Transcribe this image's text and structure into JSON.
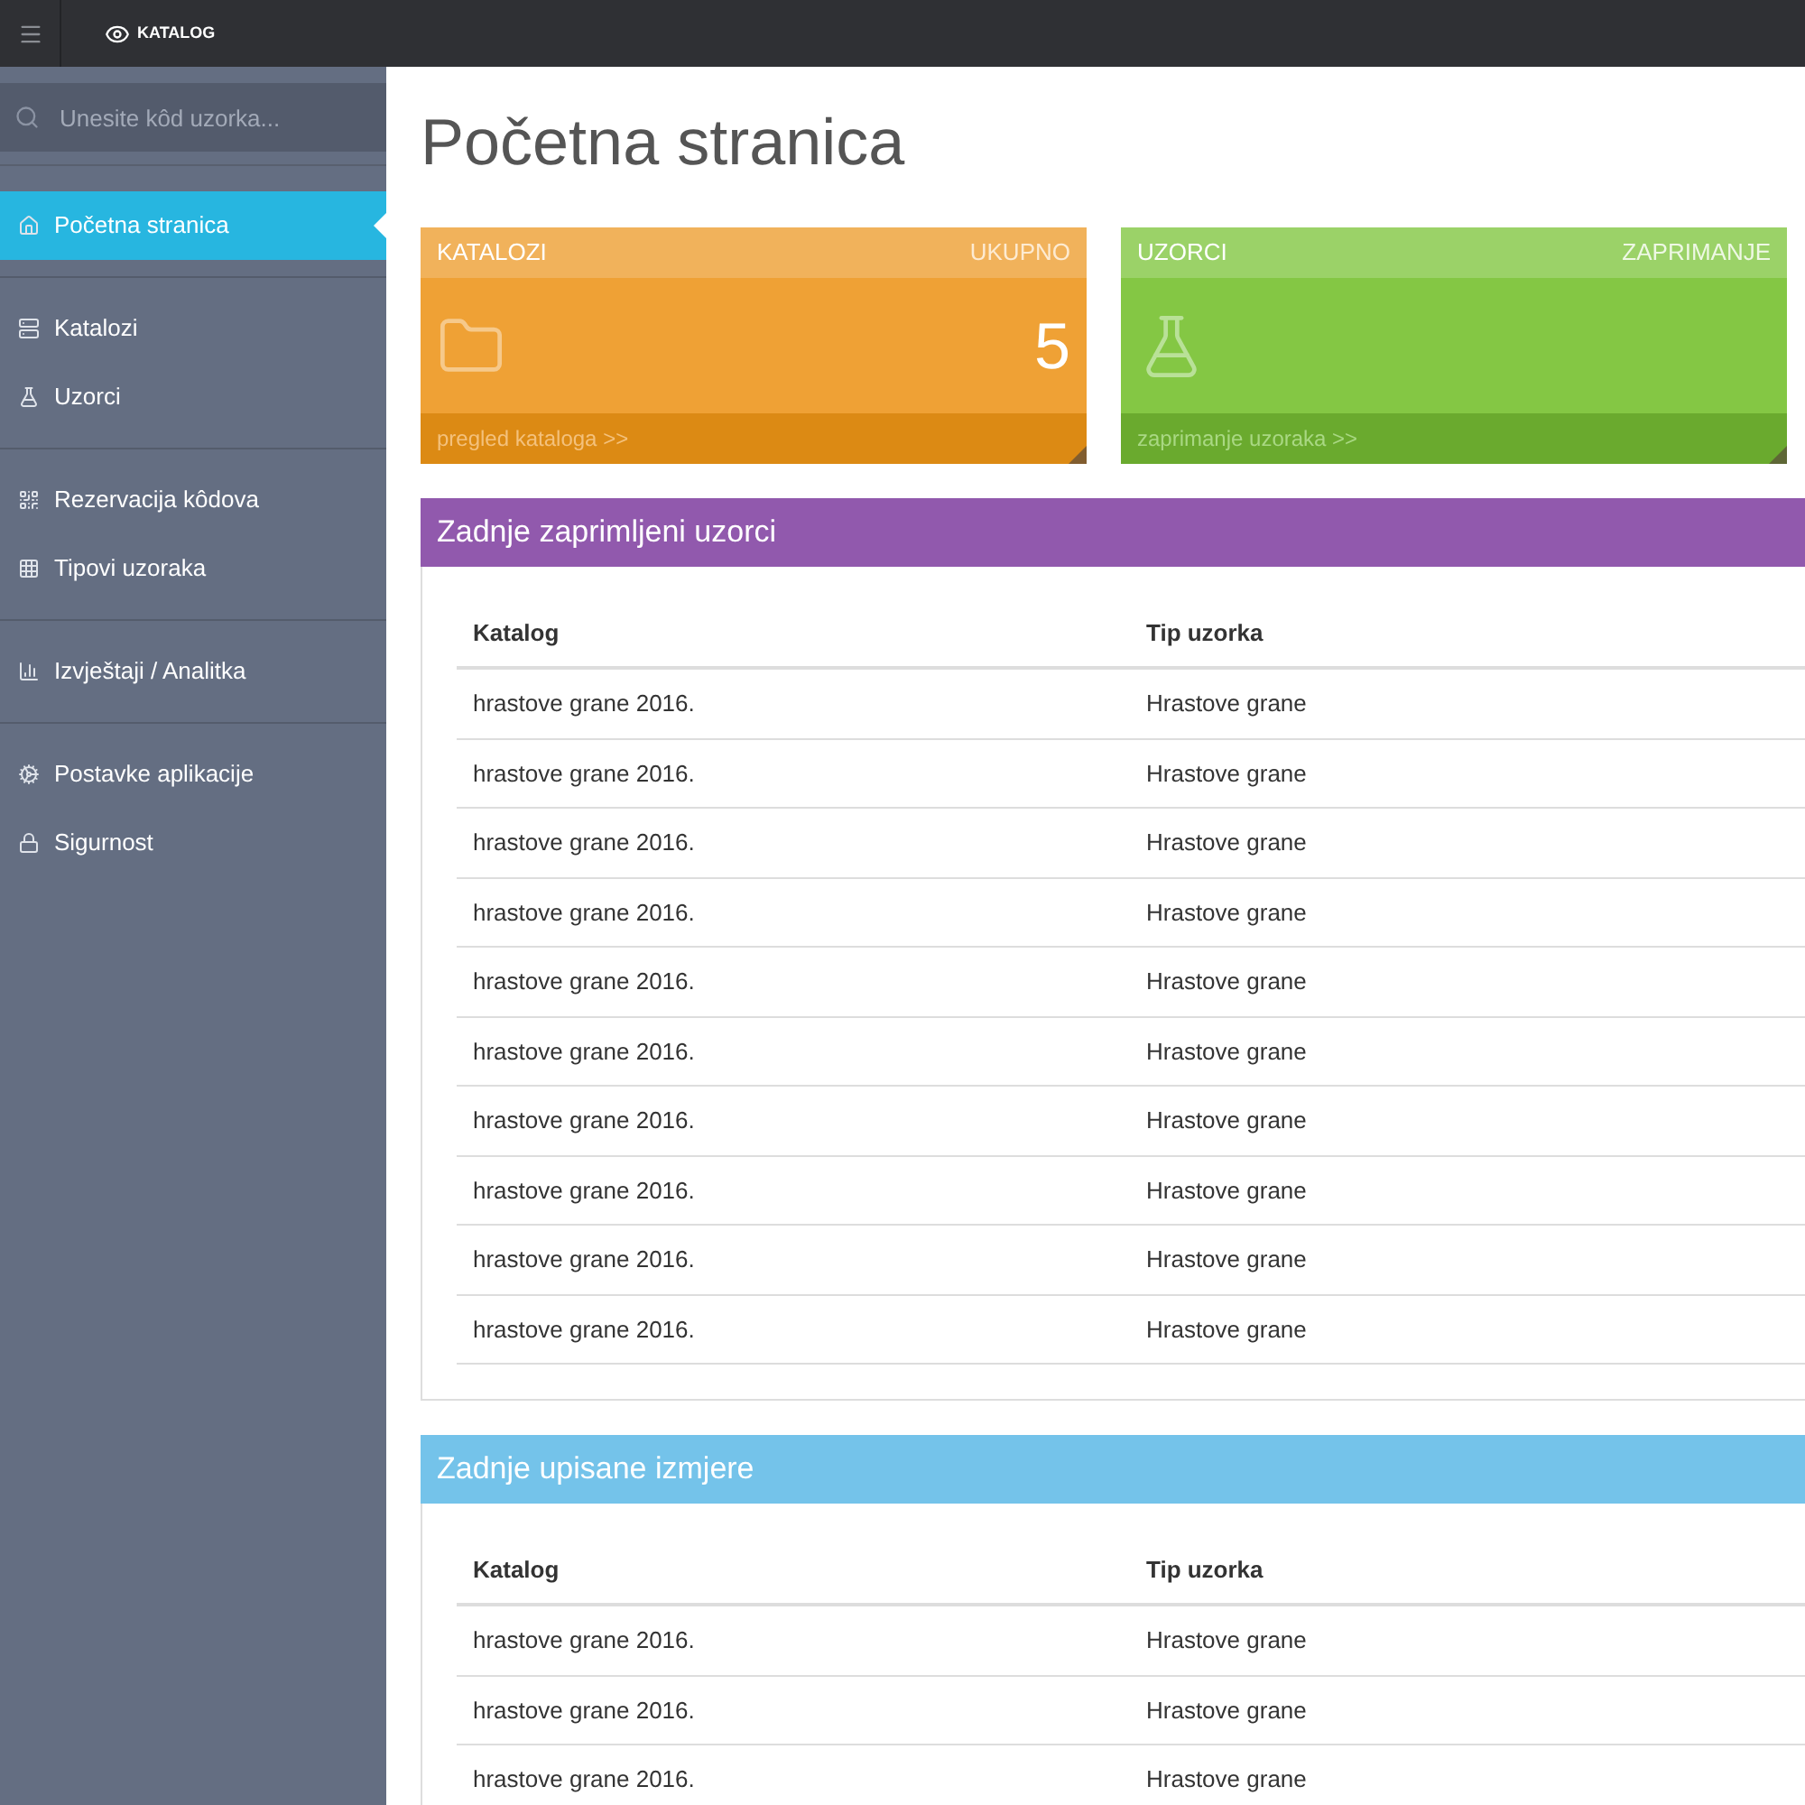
{
  "topbar": {
    "logo": "KATALOG"
  },
  "sidebar": {
    "search": {
      "placeholder": "Unesite kôd uzorka..."
    },
    "groups": [
      {
        "items": [
          {
            "label": "Početna stranica",
            "selected": true
          }
        ]
      },
      {
        "items": [
          {
            "label": "Katalozi",
            "selected": false
          },
          {
            "label": "Uzorci",
            "selected": false
          }
        ]
      },
      {
        "items": [
          {
            "label": "Rezervacija kôdova",
            "selected": false
          },
          {
            "label": "Tipovi uzoraka",
            "selected": false
          }
        ]
      },
      {
        "items": [
          {
            "label": "Izvještaji / Analitka",
            "selected": false
          }
        ]
      },
      {
        "items": [
          {
            "label": "Postavke aplikacije",
            "selected": false
          },
          {
            "label": "Sigurnost",
            "selected": false
          }
        ]
      }
    ]
  },
  "page_title": "Početna stranica",
  "tiles": [
    {
      "kind": "orange",
      "title": "KATALOZI",
      "subtitle": "UKUPNO",
      "value": "5",
      "link": "pregled kataloga >>"
    },
    {
      "kind": "green",
      "title": "UZORCI",
      "subtitle": "ZAPRIMANJE",
      "link": "zaprimanje uzoraka >>"
    }
  ],
  "panels": [
    {
      "kind": "purple",
      "title": "Zadnje zaprimljeni uzorci",
      "columns": [
        "Katalog",
        "Tip uzorka"
      ],
      "rows": [
        [
          "hrastove grane 2016.",
          "Hrastove grane"
        ],
        [
          "hrastove grane 2016.",
          "Hrastove grane"
        ],
        [
          "hrastove grane 2016.",
          "Hrastove grane"
        ],
        [
          "hrastove grane 2016.",
          "Hrastove grane"
        ],
        [
          "hrastove grane 2016.",
          "Hrastove grane"
        ],
        [
          "hrastove grane 2016.",
          "Hrastove grane"
        ],
        [
          "hrastove grane 2016.",
          "Hrastove grane"
        ],
        [
          "hrastove grane 2016.",
          "Hrastove grane"
        ],
        [
          "hrastove grane 2016.",
          "Hrastove grane"
        ],
        [
          "hrastove grane 2016.",
          "Hrastove grane"
        ]
      ]
    },
    {
      "kind": "blue",
      "title": "Zadnje upisane izmjere",
      "columns": [
        "Katalog",
        "Tip uzorka"
      ],
      "rows": [
        [
          "hrastove grane 2016.",
          "Hrastove grane"
        ],
        [
          "hrastove grane 2016.",
          "Hrastove grane"
        ],
        [
          "hrastove grane 2016.",
          "Hrastove grane"
        ]
      ]
    }
  ]
}
